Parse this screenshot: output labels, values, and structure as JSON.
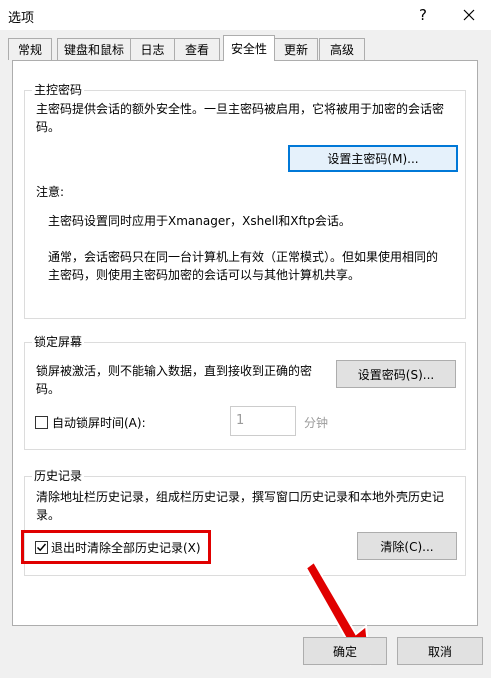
{
  "window": {
    "title": "选项",
    "help_glyph": "?"
  },
  "tabs": [
    {
      "label": "常规"
    },
    {
      "label": "键盘和鼠标"
    },
    {
      "label": "日志"
    },
    {
      "label": "查看"
    },
    {
      "label": "安全性"
    },
    {
      "label": "更新"
    },
    {
      "label": "高级"
    }
  ],
  "active_tab": "安全性",
  "master_password": {
    "group_title": "主控密码",
    "desc_line1": "主密码提供会话的额外安全性。一旦主密码被启用，它将被用于加密的会话密",
    "desc_line2": "码。",
    "set_button": "设置主密码(M)...",
    "note_label": "注意:",
    "note1": "主密码设置同时应用于Xmanager，Xshell和Xftp会话。",
    "note2_line1": "通常，会话密码只在同一台计算机上有效（正常模式）。但如果使用相同的",
    "note2_line2": "主密码，则使用主密码加密的会话可以与其他计算机共享。"
  },
  "lock_screen": {
    "group_title": "锁定屏幕",
    "desc_line1": "锁屏被激活，则不能输入数据，直到接收到正确的密",
    "desc_line2": "码。",
    "set_button": "设置密码(S)...",
    "auto_lock_label": "自动锁屏时间(A):",
    "auto_lock_checked": false,
    "minutes_value": "1",
    "minutes_unit": "分钟"
  },
  "history": {
    "group_title": "历史记录",
    "desc_line1": "清除地址栏历史记录，组成栏历史记录，撰写窗口历史记录和本地外壳历史记",
    "desc_line2": "录。",
    "clear_on_exit_label": "退出时清除全部历史记录(X)",
    "clear_on_exit_checked": true,
    "clear_button": "清除(C)..."
  },
  "footer": {
    "ok_button": "确定",
    "cancel_button": "取消"
  },
  "colors": {
    "annotation": "#e00000",
    "focus": "#0078d7"
  }
}
